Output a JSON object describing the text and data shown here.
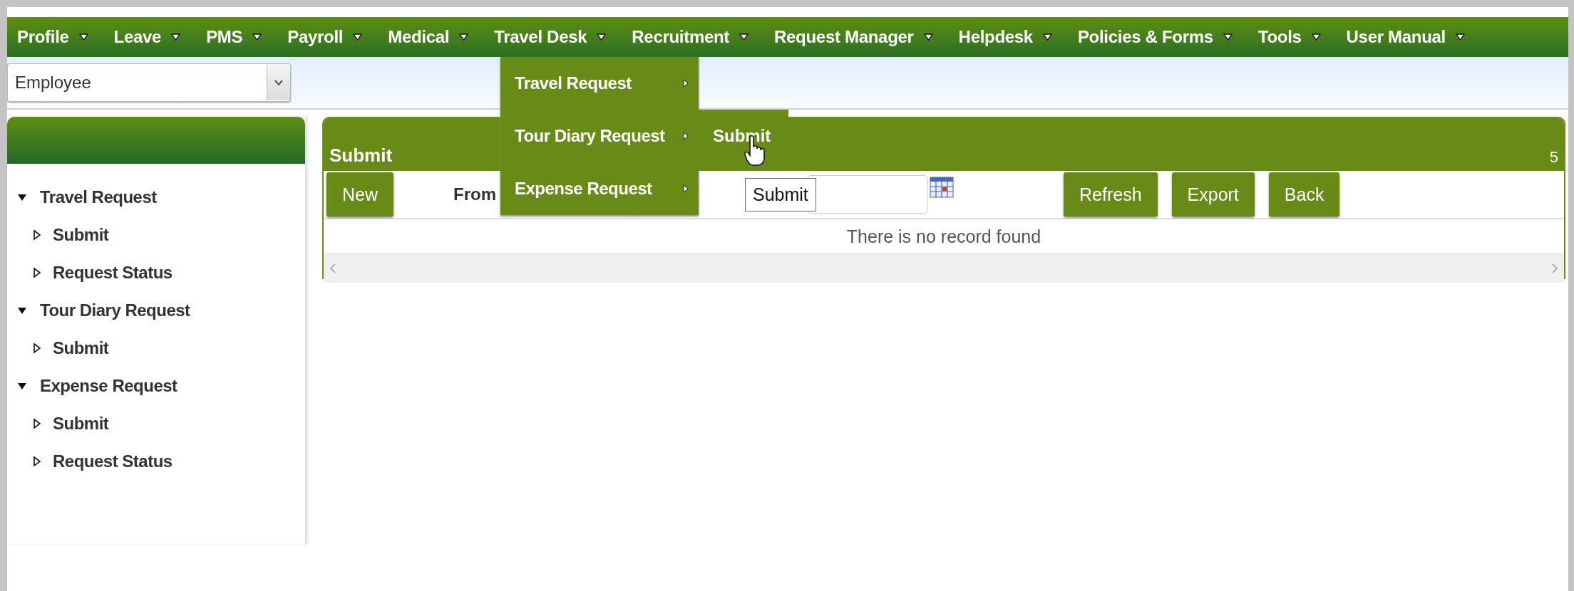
{
  "menu": [
    {
      "label": "Profile"
    },
    {
      "label": "Leave"
    },
    {
      "label": "PMS"
    },
    {
      "label": "Payroll"
    },
    {
      "label": "Medical"
    },
    {
      "label": "Travel Desk"
    },
    {
      "label": "Recruitment"
    },
    {
      "label": "Request Manager"
    },
    {
      "label": "Helpdesk"
    },
    {
      "label": "Policies & Forms"
    },
    {
      "label": "Tools"
    },
    {
      "label": "User Manual"
    }
  ],
  "role_select": {
    "value": "Employee"
  },
  "sidebar": {
    "tree": [
      {
        "label": "Travel Request",
        "expanded": true,
        "children": [
          {
            "label": "Submit"
          },
          {
            "label": "Request Status"
          }
        ]
      },
      {
        "label": "Tour Diary Request",
        "expanded": true,
        "children": [
          {
            "label": "Submit"
          }
        ]
      },
      {
        "label": "Expense Request",
        "expanded": true,
        "children": [
          {
            "label": "Submit"
          },
          {
            "label": "Request Status"
          }
        ]
      }
    ]
  },
  "panel": {
    "title": "Submit",
    "count": "5",
    "new_button": "New",
    "from_label": "From",
    "right_buttons": [
      "Refresh",
      "Export",
      "Back"
    ],
    "empty_message": "There is no record found"
  },
  "dropdown": {
    "items": [
      {
        "label": "Travel Request"
      },
      {
        "label": "Tour Diary Request"
      },
      {
        "label": "Expense Request"
      }
    ]
  },
  "submenu": {
    "items": [
      {
        "label": "Submit"
      }
    ]
  },
  "tooltip": "Submit"
}
